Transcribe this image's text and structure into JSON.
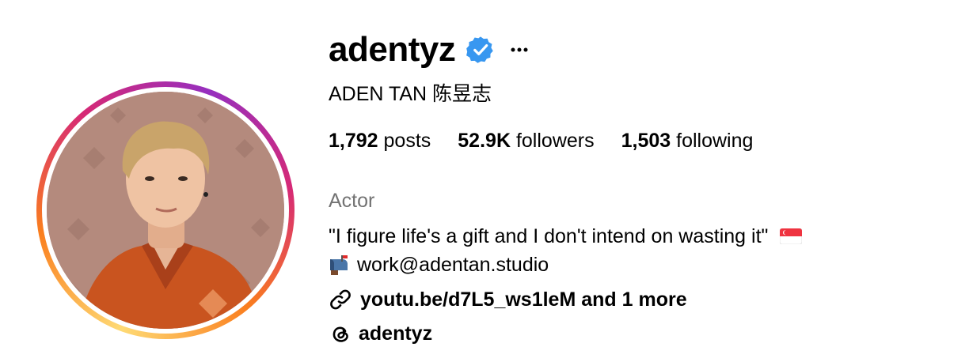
{
  "profile": {
    "username": "adentyz",
    "full_name": "ADEN TAN 陈昱志",
    "verified": true,
    "category": "Actor",
    "bio": "\"I figure life's a gift and I don't intend on wasting it\"",
    "email": "work@adentan.studio",
    "link_text": "youtu.be/d7L5_ws1leM and 1 more",
    "threads_handle": "adentyz"
  },
  "stats": {
    "posts_count": "1,792",
    "posts_label": "posts",
    "followers_count": "52.9K",
    "followers_label": "followers",
    "following_count": "1,503",
    "following_label": "following"
  },
  "icons": {
    "verified": "verified-badge-icon",
    "more": "more-options-icon",
    "flag": "singapore-flag-icon",
    "mailbox": "mailbox-icon",
    "link": "link-icon",
    "threads": "threads-icon"
  },
  "colors": {
    "verified_blue": "#3897f0",
    "muted_text": "#737373",
    "ring_gradient": [
      "#feda75",
      "#fa7e1e",
      "#d62976",
      "#962fbf"
    ]
  }
}
